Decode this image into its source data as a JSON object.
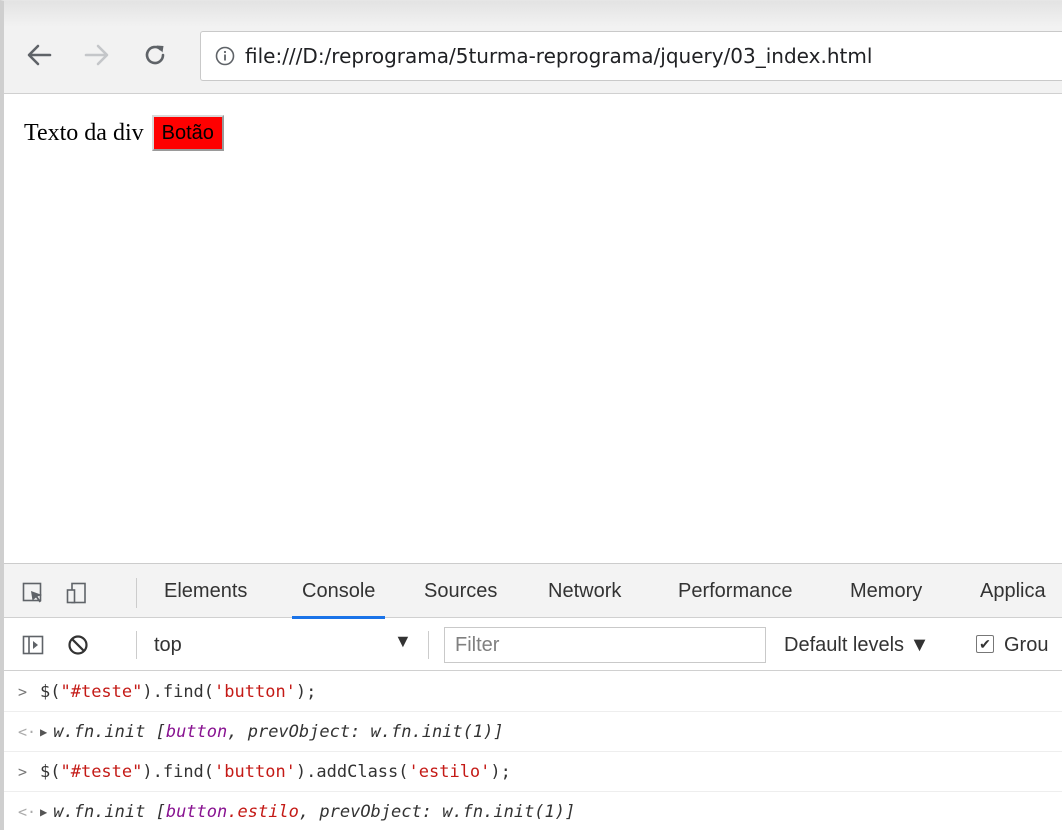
{
  "browser": {
    "url": "file:///D:/reprograma/5turma-reprograma/jquery/03_index.html"
  },
  "page": {
    "div_text": "Texto da div",
    "button_label": "Botão",
    "button_color": "#ff0000"
  },
  "devtools": {
    "tabs": [
      {
        "label": "Elements"
      },
      {
        "label": "Console"
      },
      {
        "label": "Sources"
      },
      {
        "label": "Network"
      },
      {
        "label": "Performance"
      },
      {
        "label": "Memory"
      },
      {
        "label": "Applica"
      }
    ],
    "active_tab": "Console",
    "context": "top",
    "filter_placeholder": "Filter",
    "levels_label": "Default levels ▼",
    "group_label": "Grou"
  },
  "console": {
    "lines": [
      {
        "kind": "input",
        "prefix": "$(",
        "string1": "\"#teste\"",
        "mid": ").find(",
        "string2": "'button'",
        "suffix": ");"
      },
      {
        "kind": "output",
        "head": "w.fn.init [",
        "element": "button",
        "tail": ", prevObject: w.fn.init(1)]"
      },
      {
        "kind": "input",
        "prefix": "$(",
        "string1": "\"#teste\"",
        "mid": ").find(",
        "string2": "'button'",
        "mid2": ").addClass(",
        "string3": "'estilo'",
        "suffix": ");"
      },
      {
        "kind": "output",
        "head": "w.fn.init [",
        "element": "button",
        "element_class": ".estilo",
        "tail": ", prevObject: w.fn.init(1)]"
      }
    ]
  }
}
